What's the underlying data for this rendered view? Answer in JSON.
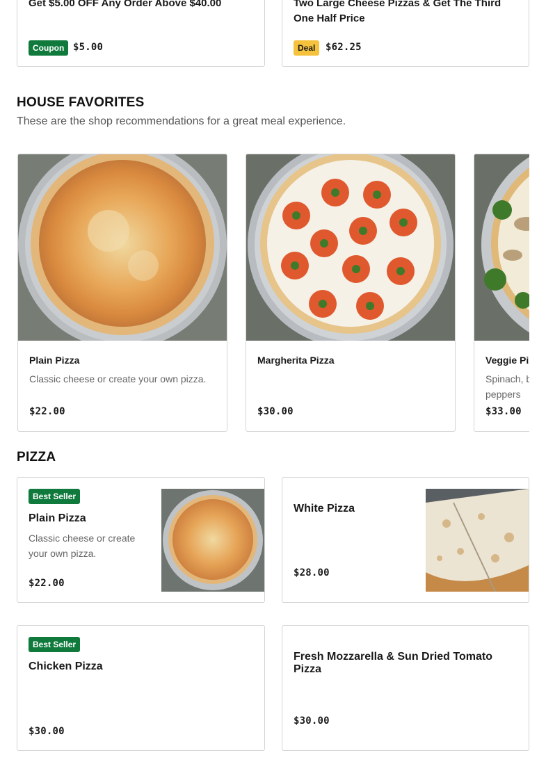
{
  "promos": [
    {
      "title": "Get $5.00 OFF Any Order Above $40.00",
      "tag": "Coupon",
      "price": "$5.00",
      "tag_color": "#0f7a3c"
    },
    {
      "title": "Two Large Cheese Pizzas & Get The Third One Half Price",
      "tag": "Deal",
      "price": "$62.25",
      "tag_color": "#f5c23e"
    }
  ],
  "house_favorites": {
    "title": "HOUSE FAVORITES",
    "subtitle": "These are the shop recommendations for a great meal experience.",
    "items": [
      {
        "name": "Plain Pizza",
        "description": "Classic cheese or create your own pizza.",
        "price": "$22.00"
      },
      {
        "name": "Margherita Pizza",
        "description": "",
        "price": "$30.00"
      },
      {
        "name": "Veggie Pizza",
        "description": "Spinach, broccoli, mushrooms, green peppers",
        "price": "$33.00"
      }
    ]
  },
  "pizza": {
    "title": "PIZZA",
    "items": [
      {
        "badge": "Best Seller",
        "name": "Plain Pizza",
        "description": "Classic cheese or create your own pizza.",
        "price": "$22.00"
      },
      {
        "badge": "",
        "name": "White Pizza",
        "description": "",
        "price": "$28.00"
      },
      {
        "badge": "Best Seller",
        "name": "Chicken Pizza",
        "description": "",
        "price": "$30.00"
      },
      {
        "badge": "",
        "name": "Fresh Mozzarella & Sun Dried Tomato Pizza",
        "description": "",
        "price": "$30.00"
      }
    ]
  },
  "colors": {
    "badge_green": "#0f7a3c",
    "deal_yellow": "#f5c23e",
    "border": "#d4d4d4"
  }
}
